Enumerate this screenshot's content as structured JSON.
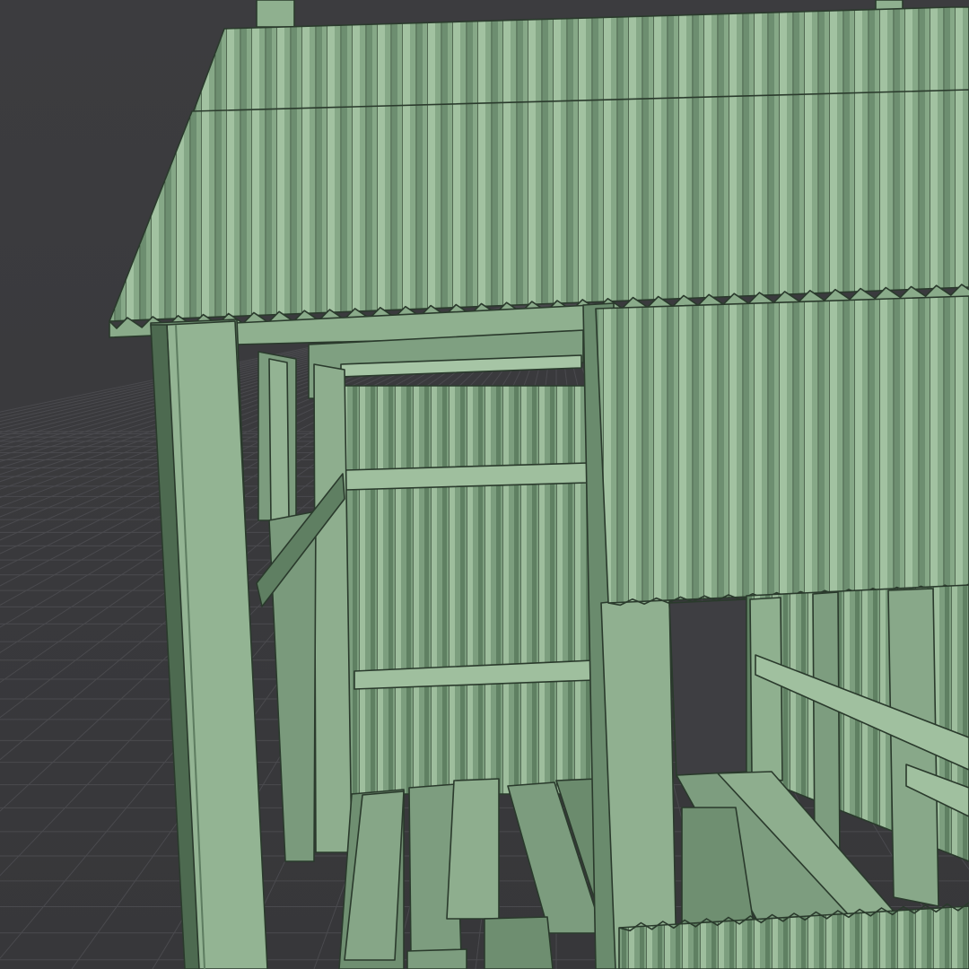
{
  "viewport": {
    "background": "#3a3a3d",
    "grid_color": "#48484c",
    "model_color": "#7e9f80",
    "model_light": "#a4c4a3",
    "model_dark": "#4f6c52",
    "edge_color": "#2a3a2c"
  },
  "scene": {
    "object": "corrugated-metal-shed",
    "view_mode": "solid-shaded-wireframe"
  }
}
